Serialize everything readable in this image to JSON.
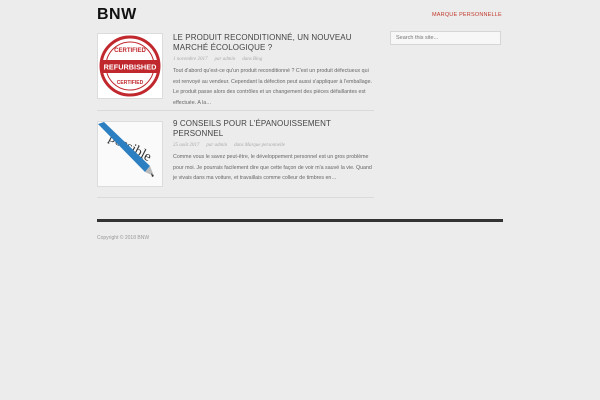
{
  "site": {
    "title": "BNW"
  },
  "nav": {
    "link": "Marque personnelle"
  },
  "search": {
    "placeholder": "Search this site..."
  },
  "posts": [
    {
      "title": "Le produit reconditionné, un nouveau marché écologique ?",
      "date": "1 novembre 2017",
      "author": "par admin",
      "category": "dans Blog",
      "excerpt": "Tout d'abord qu'est-ce qu'un produit reconditionné ? C'est un produit défectueux qui est renvoyé au vendeur. Cependant la défection peut aussi s'appliquer à l'emballage. Le produit passe alors des contrôles et un changement des pièces défaillantes est effectuée. A la…",
      "image": {
        "icon": "refurbished-stamp-icon",
        "text_top": "CERTIFIED",
        "text_middle": "REFURBISHED",
        "text_bottom": "CERTIFIED"
      }
    },
    {
      "title": "9 conseils pour l'épanouissement personnel",
      "date": "25 août 2017",
      "author": "par admin",
      "category": "dans Marque personnelle",
      "excerpt": "Comme vous le savez peut-être, le développement personnel est un gros problème pour moi. Je pourrais facilement dire que cette façon de voir m'a sauvé la vie. Quand je vivais dans ma voiture, et travaillais comme colleur de timbres en…",
      "image": {
        "icon": "pen-writing-icon",
        "text": "possible"
      }
    }
  ],
  "footer": {
    "copyright": "Copyright © 2018 BNW"
  },
  "colors": {
    "accent": "#c0392b",
    "background": "#ececec",
    "stamp": "#c0282d"
  }
}
